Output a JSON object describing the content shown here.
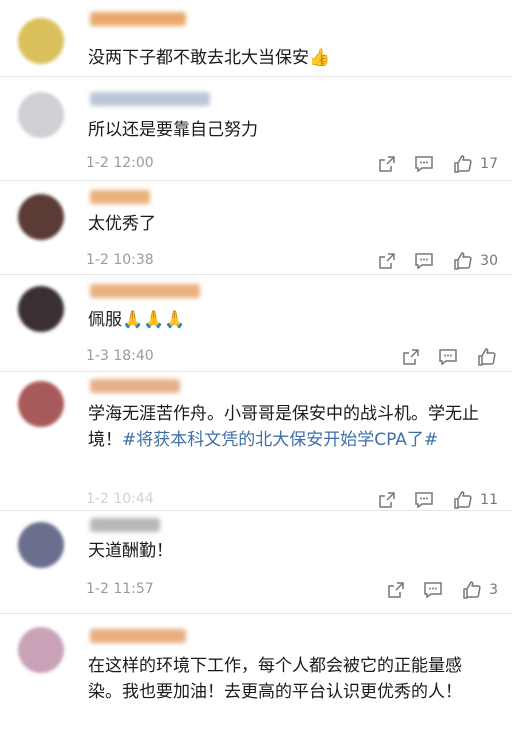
{
  "comments": [
    {
      "user": "",
      "text": "没两下子都不敢去北大当保安👍",
      "time": "",
      "likes": "",
      "colors": {
        "avatar": "#d9c05a",
        "name": "#e7a96b"
      }
    },
    {
      "user": "",
      "text": "所以还是要靠自己努力",
      "time": "1-2 12:00",
      "likes": "17",
      "colors": {
        "avatar": "#cfcfd4",
        "name": "#b9c7d9"
      }
    },
    {
      "user": "",
      "text": "太优秀了",
      "time": "1-2 10:38",
      "likes": "30",
      "colors": {
        "avatar": "#5a3b35",
        "name": "#e9b07a"
      }
    },
    {
      "user": "",
      "text": "佩服🙏🙏🙏",
      "time": "1-3 18:40",
      "likes": "",
      "colors": {
        "avatar": "#3a3032",
        "name": "#e8b07d"
      }
    },
    {
      "user": "",
      "text": "学海无涯苦作舟。小哥哥是保安中的战斗机。学无止境！",
      "topic": "#将获本科文凭的北大保安开始学CPA了#",
      "time": "1-2 10:44",
      "likes": "11",
      "colors": {
        "avatar": "#a85a5a",
        "name": "#e7b08a"
      }
    },
    {
      "user": "",
      "text": "天道酬勤！",
      "time": "1-2 11:57",
      "likes": "3",
      "colors": {
        "avatar": "#6a6f8e",
        "name": "#b8b8b8"
      }
    },
    {
      "user": "",
      "text": "在这样的环境下工作，每个人都会被它的正能量感染。我也要加油！去更高的平台认识更优秀的人！",
      "time": "",
      "likes": "",
      "colors": {
        "avatar": "#c9a2b8",
        "name": "#e8ae7e"
      }
    }
  ]
}
